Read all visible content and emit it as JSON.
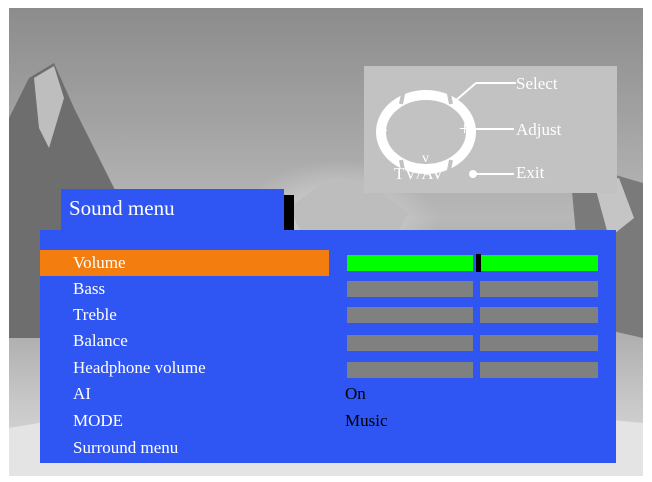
{
  "remote_panel": {
    "select_label": "Select",
    "adjust_label": "Adjust",
    "exit_label": "Exit",
    "tvav_label": "TV/AV",
    "up_glyph": "^",
    "down_glyph": "v",
    "minus_glyph": "-",
    "plus_glyph": "+"
  },
  "menu": {
    "title": "Sound menu",
    "items": [
      {
        "label": "Volume",
        "selected": true,
        "level": 0.52
      },
      {
        "label": "Bass"
      },
      {
        "label": "Treble"
      },
      {
        "label": "Balance"
      },
      {
        "label": "Headphone volume"
      },
      {
        "label": "AI",
        "value": "On"
      },
      {
        "label": "MODE",
        "value": "Music"
      },
      {
        "label": "Surround menu"
      }
    ]
  },
  "colors": {
    "menu_blue": "#2f55f2",
    "selected_orange": "#f47d10",
    "active_bar_green": "#00ff00",
    "inactive_bar_gray": "#808080",
    "help_panel_gray": "#c2c2c2"
  }
}
